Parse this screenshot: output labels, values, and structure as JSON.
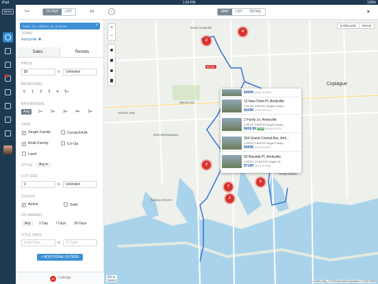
{
  "status_bar": {
    "left": "iPad",
    "time": "1:54 PM",
    "right": "100%"
  },
  "rail": {
    "menu_label": "MENU",
    "items": [
      "search",
      "inbox",
      "chat",
      "messages",
      "calendar",
      "documents",
      "home",
      "like",
      "profile"
    ]
  },
  "toolbar": {
    "filter_label": "FILTER",
    "list_label": "LIST",
    "view_tabs": [
      "MAP",
      "LIST",
      "DETAIL"
    ]
  },
  "search": {
    "placeholder": "Town, Zip, Address, ID, or MLS#"
  },
  "filters": {
    "town_label": "TOWN",
    "town_value": "Amityville",
    "tabs": [
      "Sales",
      "Rentals"
    ],
    "price_label": "PRICE",
    "price_min": "$0",
    "price_max": "Unlimited",
    "to": "to",
    "bedrooms_label": "BEDROOMS",
    "bedrooms": [
      "0",
      "1",
      "2",
      "3",
      "4",
      "5+"
    ],
    "bathrooms_label": "BATHROOMS",
    "bathrooms": [
      "Any",
      "1+",
      "2+",
      "3+",
      "4+",
      "5+"
    ],
    "type_label": "TYPE",
    "types": [
      "Single Family",
      "Condo/HOA",
      "Multi-Family",
      "Co-Op",
      "Land"
    ],
    "style_label": "STYLE",
    "style_value": "Any",
    "lot_label": "LOT SIZE",
    "lot_min": "0",
    "lot_max": "Unlimited",
    "status_label": "STATUS",
    "statuses": [
      "Active",
      "Sold"
    ],
    "market_label": "ON MARKET",
    "market": [
      "Any",
      "1 Day",
      "7 Days",
      "30 Days"
    ],
    "title_date_label": "TITLE DATE",
    "from_date": "From Date",
    "to_date": "To Date",
    "additional": "+ ADDITIONAL FILTERS"
  },
  "listings": {
    "count": "42",
    "label": "Listings"
  },
  "map": {
    "type_buttons": [
      "SATELLITE",
      "ROAD"
    ],
    "labels": [
      "North Amityville",
      "Amityville",
      "Copiague",
      "East Massapequa",
      "Amity Harbor",
      "Sunrise Hwy",
      "Merrick Rd",
      "Nassau Shores",
      "Harbor Isle",
      "Sunrise Park"
    ],
    "pins": [
      "2",
      "4",
      "2",
      "7",
      "2",
      "5",
      "2"
    ],
    "price_tag": "$470K",
    "scale": [
      "500 m",
      "2000 ft"
    ],
    "attribution": "Leaflet | Bing, © 2018 Microsoft Corporation, © 2018 HERE"
  },
  "popup": [
    {
      "title": "",
      "details": "",
      "price": "$400K",
      "mls": "MLS# 2963838"
    },
    {
      "title": "12 New Point Pl, Amityville",
      "details": "3 BEDS 3 BATHS Single-Family...",
      "price": "$429K",
      "mls": "MLS# 2997422"
    },
    {
      "title": "2 Purdy Ln, Amityville",
      "details": "4 BEDS 3 BATHS Single-Family...",
      "price": "$459.9K",
      "new": "NEW",
      "mls": "MLS# 3021119"
    },
    {
      "title": "264 Grand Central Ave, Ami...",
      "details": "4 BEDS 3 BATHS Single-Family...",
      "price": "$469K",
      "mls": "MLS# 2999072"
    },
    {
      "title": "60 Bayside Pl, Amityville",
      "details": "3 BEDS 2.5 BATHS Single-Fa...",
      "price": "$719K",
      "mls": "MLS# 2976689"
    }
  ]
}
